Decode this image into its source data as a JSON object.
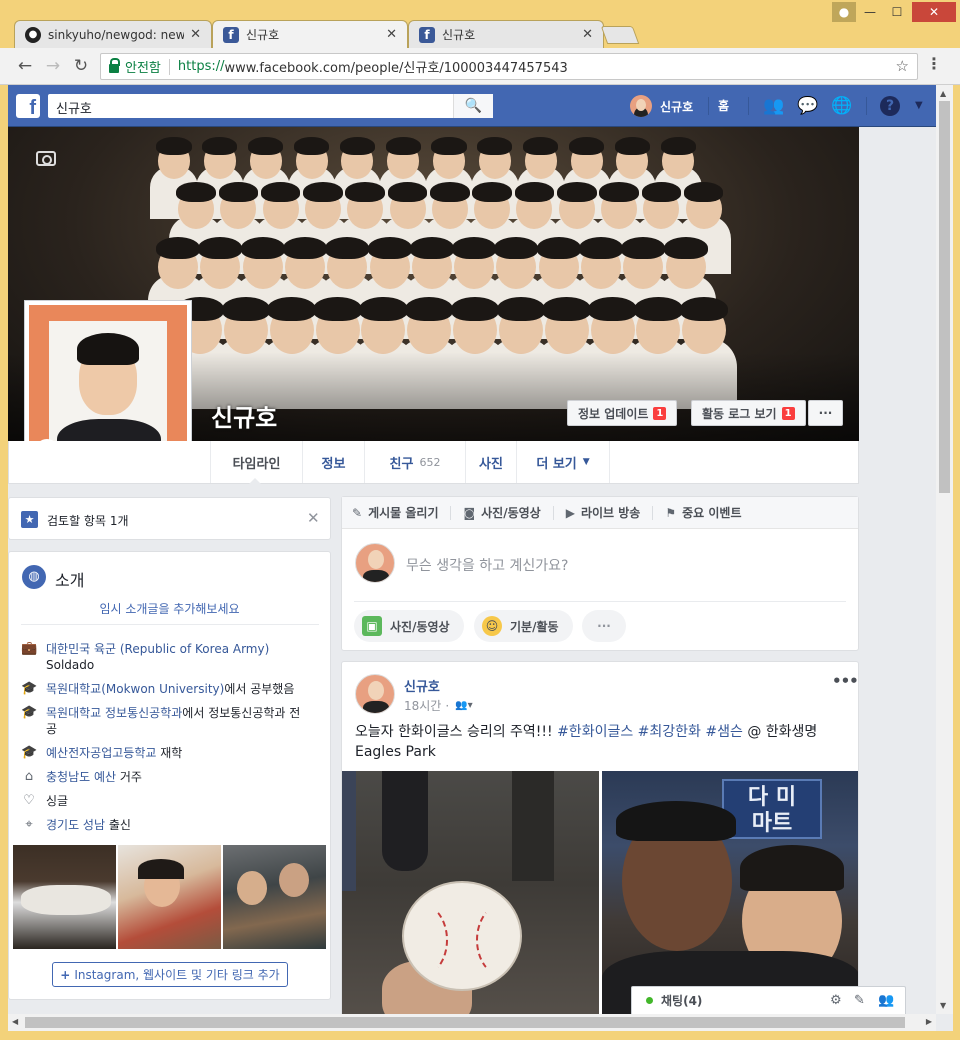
{
  "browser": {
    "tabs": [
      {
        "title": "sinkyuho/newgod: newg",
        "favicon": "github-icon",
        "active": false
      },
      {
        "title": "신규호",
        "favicon": "facebook-icon",
        "active": true
      },
      {
        "title": "신규호",
        "favicon": "facebook-icon",
        "active": false
      }
    ],
    "secure_label": "안전함",
    "url_protocol": "https://",
    "url_rest": "www.facebook.com/people/신규호/100003447457543"
  },
  "fb_header": {
    "search_value": "신규호",
    "profile_name": "신규호",
    "home_label": "홈",
    "icons": [
      "friends-icon",
      "messenger-icon",
      "globe-icon",
      "help-icon"
    ]
  },
  "profile": {
    "name": "신규호",
    "update_info_label": "정보 업데이트",
    "update_info_badge": "1",
    "activity_log_label": "활동 로그 보기",
    "activity_log_badge": "1",
    "more_label": "···"
  },
  "nav_tabs": [
    {
      "label": "타임라인",
      "active": true
    },
    {
      "label": "정보"
    },
    {
      "label": "친구",
      "count": "652"
    },
    {
      "label": "사진"
    },
    {
      "label": "더 보기"
    }
  ],
  "review": {
    "label": "검토할 항목 1개"
  },
  "intro": {
    "title": "소개",
    "add_intro": "임시 소개글을 추가해보세요",
    "items": [
      {
        "icon": "work-icon",
        "link": "대한민국 육군 (Republic of Korea Army)",
        "sub": "Soldado"
      },
      {
        "icon": "education-icon",
        "link": "목원대학교(Mokwon University)",
        "text": "에서 공부했음"
      },
      {
        "icon": "education-icon",
        "link": "목원대학교 정보통신공학과",
        "text": "에서 정보통신공학과 전공"
      },
      {
        "icon": "education-icon",
        "link": "예산전자공업고등학교",
        "text": " 재학"
      },
      {
        "icon": "home-icon",
        "link": "충청남도 예산",
        "text": " 거주"
      },
      {
        "icon": "heart-icon",
        "text": "싱글"
      },
      {
        "icon": "location-icon",
        "link": "경기도 성남",
        "text": " 출신"
      }
    ],
    "add_links": "Instagram, 웹사이트 및 기타 링크 추가"
  },
  "composer": {
    "tabs": [
      "게시물 올리기",
      "사진/동영상",
      "라이브 방송",
      "중요 이벤트"
    ],
    "placeholder": "무슨 생각을 하고 계신가요?",
    "pills": [
      "사진/동영상",
      "기분/활동",
      "···"
    ]
  },
  "post": {
    "author": "신규호",
    "time": "18시간",
    "text_prefix": "오늘자 한화이글스 승리의 주역!!! ",
    "tags": [
      "#한화이글스",
      "#최강한화",
      "#샘슨"
    ],
    "text_suffix": " @ 한화생명 Eagles Park",
    "sign_text": "다 미\n마트"
  },
  "chat": {
    "label": "채팅(4)"
  },
  "colors": {
    "fb_blue": "#4267b2",
    "link": "#365899",
    "badge": "#fa3e3e",
    "chrome_frame": "#f3d27a"
  }
}
